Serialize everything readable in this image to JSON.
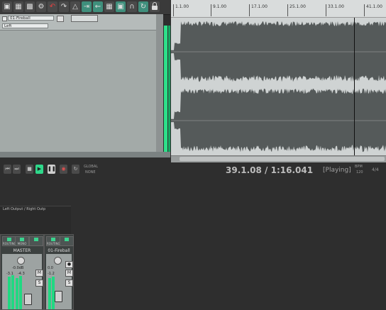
{
  "ruler": {
    "ticks": [
      "1.1.00",
      "9.1.00",
      "17.1.00",
      "25.1.00",
      "33.1.00",
      "41.1.00"
    ]
  },
  "track": {
    "name": "01-Fireball",
    "input_label": "Left"
  },
  "transport": {
    "time": "39.1.08 / 1:16.041",
    "status": "[Playing]",
    "bpm_label": "BPM",
    "bpm": "120",
    "time_sig": "4/4",
    "global_label": "GLOBAL",
    "global_sub": "NONE"
  },
  "mixer": {
    "routing_label": "Left Output / Right Outp",
    "master": {
      "name": "MASTER",
      "route_label": "ROUTING",
      "fx_label": "MONO",
      "volume": "-0.0dB",
      "peak_l": "-3.1",
      "peak_r": "-4.3",
      "m": "M",
      "s": "S"
    },
    "track": {
      "name": "01-Fireball",
      "route_label": "ROUTING",
      "volume": "0.0",
      "peak": "-1.2",
      "m": "M",
      "s": "S",
      "rec": "●"
    }
  },
  "colors": {
    "meter": "#21d882",
    "accent": "#3f8f7c"
  }
}
